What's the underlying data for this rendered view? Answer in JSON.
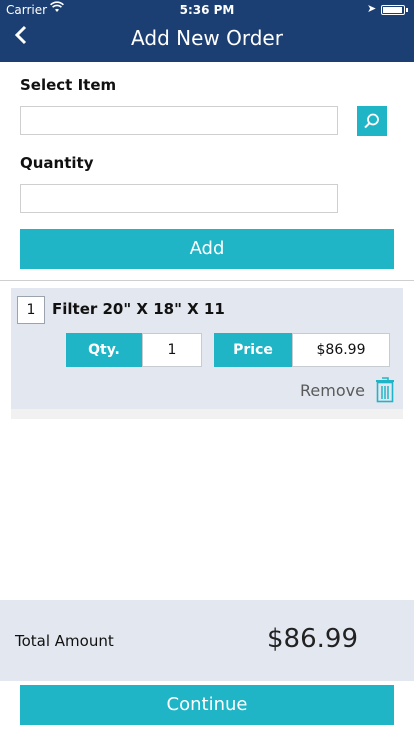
{
  "status": {
    "carrier": "Carrier",
    "time": "5:36 PM"
  },
  "nav": {
    "title": "Add New Order"
  },
  "form": {
    "select_item_label": "Select Item",
    "select_item_value": "",
    "quantity_label": "Quantity",
    "quantity_value": "",
    "add_label": "Add"
  },
  "items": [
    {
      "line_no": "1",
      "name": "Filter 20\" X  18\" X 11",
      "qty_label": "Qty.",
      "qty": "1",
      "price_label": "Price",
      "price": "$86.99",
      "remove_label": "Remove"
    }
  ],
  "total": {
    "label": "Total Amount",
    "value": "$86.99"
  },
  "continue_label": "Continue",
  "colors": {
    "nav": "#1c3f73",
    "accent": "#1fb5c7",
    "panel": "#e3e8f0"
  }
}
